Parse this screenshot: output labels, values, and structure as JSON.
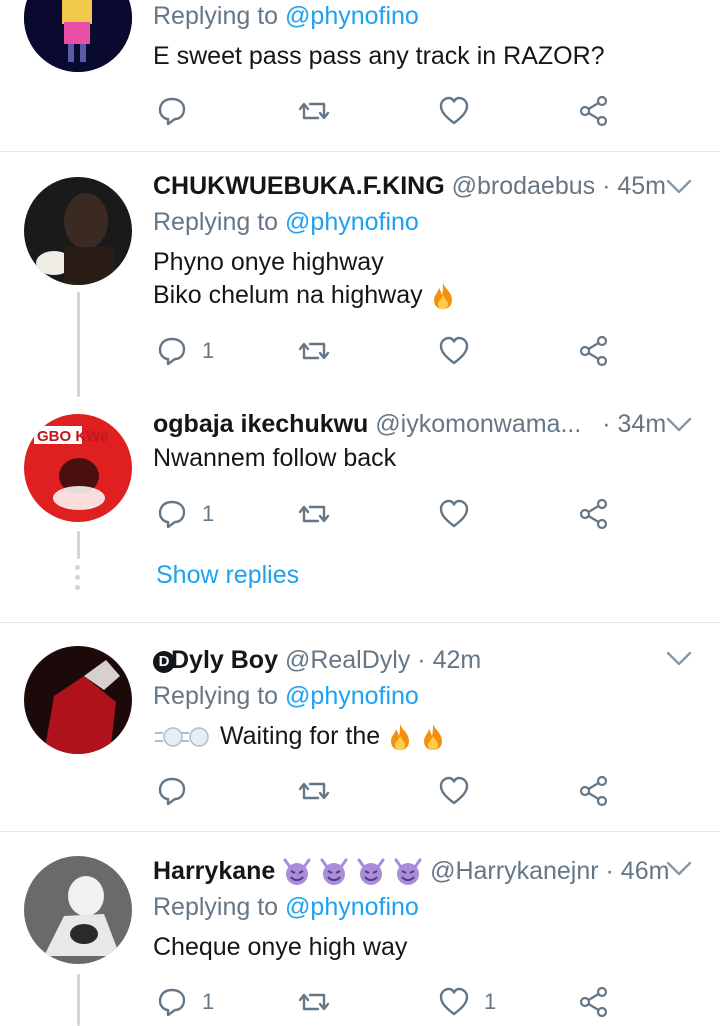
{
  "tweets": [
    {
      "reply_prefix": "Replying to",
      "reply_to": "@phynofino",
      "body": [
        "E sweet pass pass any track in RAZOR?"
      ],
      "reply_count": "",
      "like_count": ""
    },
    {
      "name": "CHUKWUEBUKA.F.KING",
      "handle": "@brodaebus",
      "time": "· 45m",
      "reply_prefix": "Replying to",
      "reply_to": "@phynofino",
      "body": [
        "Phyno onye highway",
        "Biko chelum na highway"
      ],
      "reply_count": "1",
      "like_count": ""
    },
    {
      "name": "ogbaja ikechukwu",
      "handle": "@iykomonwama...",
      "time": "· 34m",
      "body": [
        "Nwannem follow back"
      ],
      "reply_count": "1",
      "like_count": "",
      "avatar_text": "GBO KWe"
    },
    {
      "name": "Dyly Boy",
      "name_badge": "D",
      "handle": "@RealDyly",
      "time": "· 42m",
      "reply_prefix": "Replying to",
      "reply_to": "@phynofino",
      "body": [
        "Waiting for the"
      ],
      "reply_count": "",
      "like_count": ""
    },
    {
      "name": "Harrykane",
      "handle": "@Harrykanejnr",
      "time": "· 46m",
      "reply_prefix": "Replying to",
      "reply_to": "@phynofino",
      "body": [
        "Cheque onye high way"
      ],
      "reply_count": "1",
      "like_count": "1"
    }
  ],
  "show_replies": "Show replies",
  "colors": {
    "link": "#1da1f2",
    "muted": "#657786",
    "divider": "#e1e8ed",
    "thread": "#ccd6dd"
  },
  "icons": [
    "reply-icon",
    "retweet-icon",
    "like-icon",
    "share-icon",
    "chevron-down-icon",
    "fire-emoji",
    "devil-emoji",
    "dash-emoji"
  ]
}
